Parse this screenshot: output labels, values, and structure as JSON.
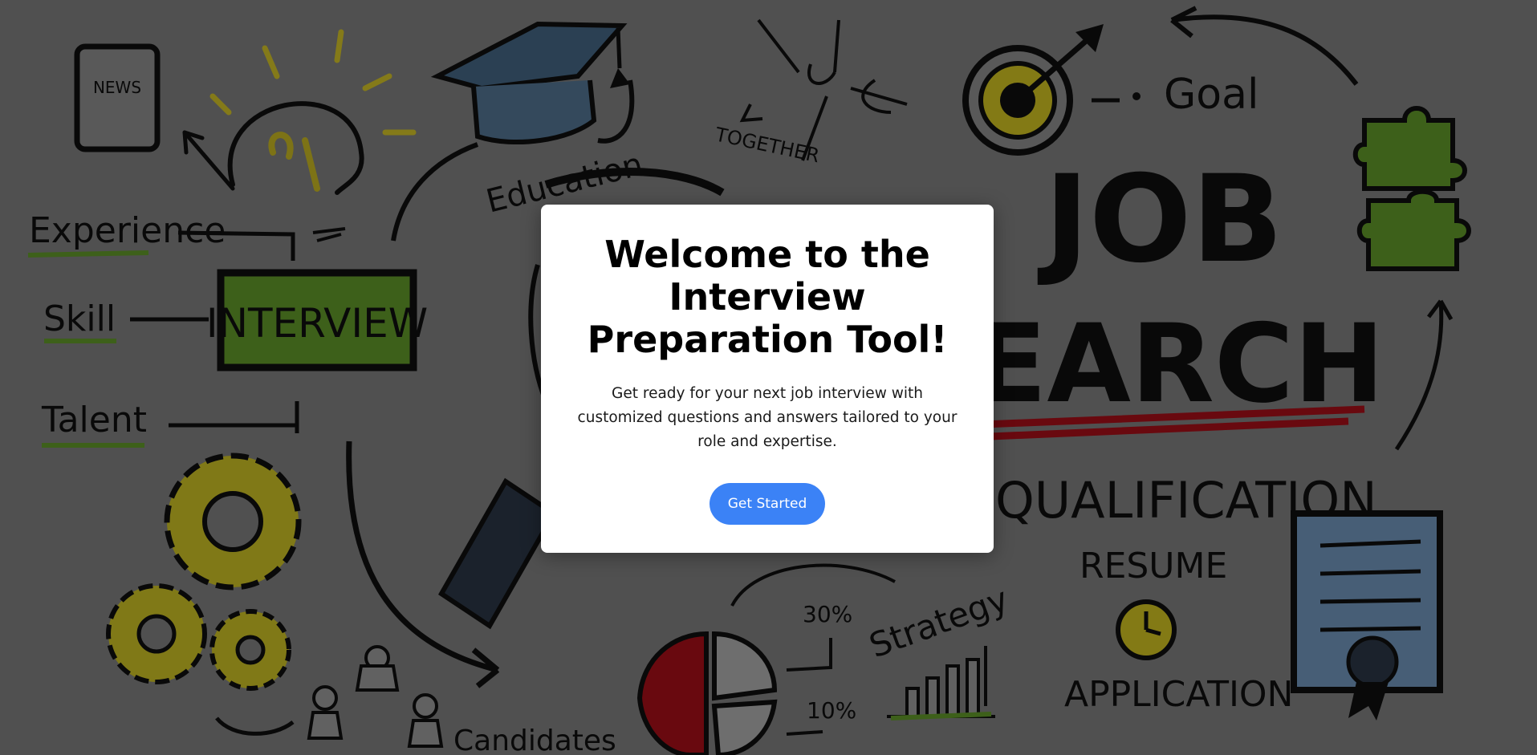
{
  "colors": {
    "accent": "#3b82f6",
    "modal_background": "#ffffff",
    "overlay": "rgba(0,0,0,0.42)",
    "chalkboard": "#8a8a8a"
  },
  "background": {
    "headline": [
      "JOB",
      "SEARCH"
    ],
    "words": {
      "news": "NEWS",
      "education": "Education",
      "together": "TOGETHER",
      "goal": "Goal",
      "experience": "Experience",
      "skill": "Skill",
      "interview": "INTERVIEW",
      "talent": "Talent",
      "qualification": "QUALIFICATION",
      "resume": "RESUME",
      "application": "APPLICATION",
      "strategy": "Strategy",
      "candidates": "Candidates",
      "pct_30": "30%",
      "pct_10": "10%"
    },
    "icons": [
      "tablet-icon",
      "lightbulb-icon",
      "graduation-cap-icon",
      "hands-icon",
      "target-icon",
      "puzzle-icon",
      "gears-icon",
      "magnifier-icon",
      "pie-chart-icon",
      "bar-chart-icon",
      "clock-icon",
      "certificate-icon",
      "people-icon"
    ]
  },
  "modal": {
    "title": "Welcome to the Interview Preparation Tool!",
    "description": "Get ready for your next job interview with customized questions and answers tailored to your role and expertise.",
    "button_label": "Get Started"
  }
}
